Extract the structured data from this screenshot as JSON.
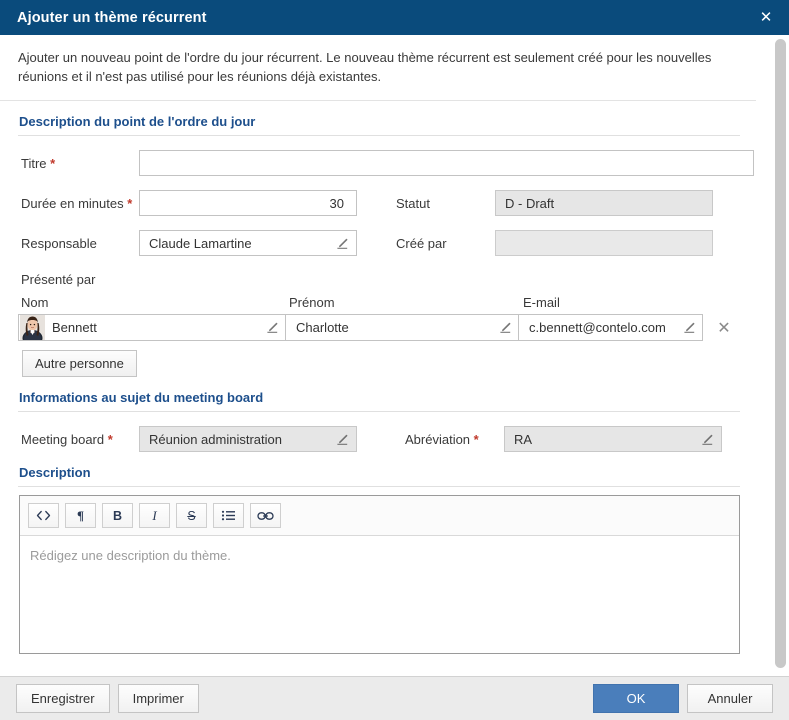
{
  "window": {
    "title": "Ajouter un thème récurrent",
    "close_icon": "close-icon"
  },
  "intro": "Ajouter un nouveau point de l'ordre du jour récurrent. Le nouveau thème récurrent est seulement créé pour les nouvelles réunions et il n'est pas utilisé pour les réunions déjà existantes.",
  "sections": {
    "agenda": {
      "title": "Description du point de l'ordre du jour",
      "fields": {
        "titre_label": "Titre",
        "titre_value": "",
        "duree_label": "Durée en minutes",
        "duree_value": "30",
        "statut_label": "Statut",
        "statut_value": "D - Draft",
        "responsable_label": "Responsable",
        "responsable_value": "Claude Lamartine",
        "cree_par_label": "Créé par",
        "cree_par_value": ""
      },
      "presented_by": {
        "group_label": "Présenté par",
        "columns": [
          "Nom",
          "Prénom",
          "E-mail"
        ],
        "rows": [
          {
            "nom": "Bennett",
            "prenom": "Charlotte",
            "email": "c.bennett@contelo.com",
            "avatar": "avatar-photo-charlotte-bennett"
          }
        ],
        "add_button": "Autre personne"
      }
    },
    "meeting_board": {
      "title": "Informations au sujet du meeting board",
      "fields": {
        "board_label": "Meeting board",
        "board_value": "Réunion administration",
        "abbrev_label": "Abréviation",
        "abbrev_value": "RA"
      }
    },
    "description": {
      "title": "Description",
      "toolbar": [
        {
          "name": "code-icon",
          "glyph": "<>"
        },
        {
          "name": "paragraph-icon",
          "glyph": "¶"
        },
        {
          "name": "bold-icon",
          "glyph": "B"
        },
        {
          "name": "italic-icon",
          "glyph": "I"
        },
        {
          "name": "strikethrough-icon",
          "glyph": "S"
        },
        {
          "name": "bullet-list-icon",
          "glyph": "☰"
        },
        {
          "name": "link-icon",
          "glyph": "∞"
        }
      ],
      "placeholder": "Rédigez une description du thème."
    }
  },
  "footer": {
    "save": "Enregistrer",
    "print": "Imprimer",
    "ok": "OK",
    "cancel": "Annuler"
  },
  "colors": {
    "titlebar": "#0a4b7c",
    "section_heading": "#1d4f8c",
    "required_asterisk": "#c0392b",
    "primary_button": "#4a7ebb",
    "footer_bg": "#ebebeb",
    "readonly_field": "#e6e6e6"
  },
  "required_marker": "*"
}
